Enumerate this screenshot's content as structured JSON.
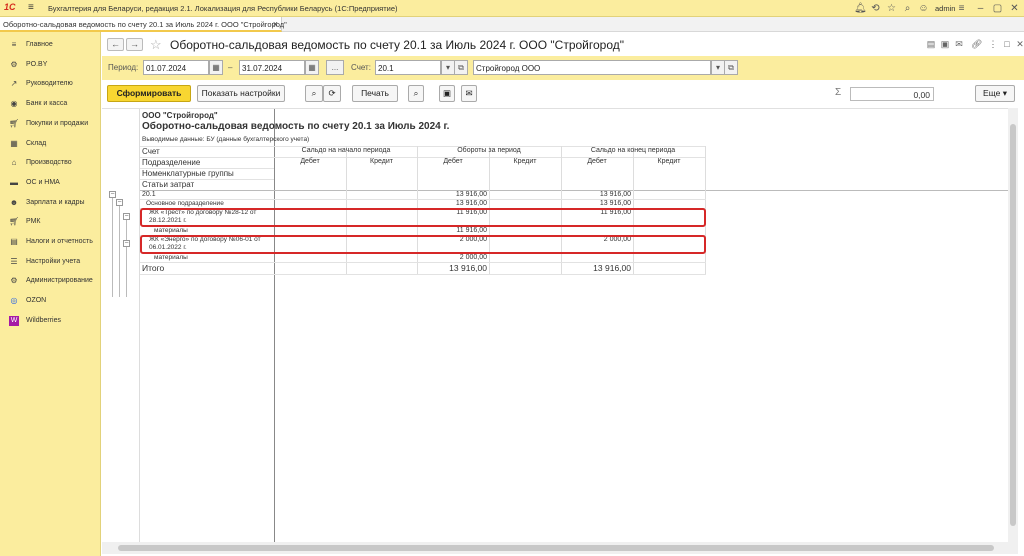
{
  "app": {
    "title": "Бухгалтерия для Беларуси, редакция 2.1. Локализация для Республики Беларусь   (1С:Предприятие)",
    "logo_text": "1С",
    "user": "admin"
  },
  "tab": {
    "label": "Оборотно-сальдовая ведомость по счету 20.1 за Июль 2024 г. ООО \"Стройгород\"",
    "close": "×"
  },
  "sidebar": {
    "items": [
      {
        "label": "Главное",
        "icon": "menu-icon"
      },
      {
        "label": "PO.BY",
        "icon": "settings-icon"
      },
      {
        "label": "Руководителю",
        "icon": "chart-icon"
      },
      {
        "label": "Банк и касса",
        "icon": "bank-icon"
      },
      {
        "label": "Покупки и продажи",
        "icon": "cart-icon"
      },
      {
        "label": "Склад",
        "icon": "warehouse-icon"
      },
      {
        "label": "Производство",
        "icon": "factory-icon"
      },
      {
        "label": "ОС и НМА",
        "icon": "car-icon"
      },
      {
        "label": "Зарплата и кадры",
        "icon": "people-icon"
      },
      {
        "label": "РМК",
        "icon": "cart-icon"
      },
      {
        "label": "Налоги и отчетность",
        "icon": "tax-icon"
      },
      {
        "label": "Настройки учета",
        "icon": "list-icon"
      },
      {
        "label": "Администрирование",
        "icon": "gear-icon"
      },
      {
        "label": "OZON",
        "icon": "ozon-icon"
      },
      {
        "label": "Wildberries",
        "icon": "wildberries-icon"
      }
    ]
  },
  "header": {
    "title": "Оборотно-сальдовая ведомость по счету 20.1 за Июль 2024 г. ООО \"Стройгород\""
  },
  "filters": {
    "period_label": "Период:",
    "date_from": "01.07.2024",
    "dash": "–",
    "date_to": "31.07.2024",
    "dots": "...",
    "account_label": "Счет:",
    "account": "20.1",
    "organization": "Стройгород ООО"
  },
  "toolbar": {
    "generate": "Сформировать",
    "settings": "Показать настройки",
    "print": "Печать",
    "sum_value": "0,00",
    "more": "Еще"
  },
  "report": {
    "org": "ООО \"Стройгород\"",
    "title": "Оборотно-сальдовая ведомость по счету 20.1 за Июль 2024 г.",
    "output_data": "Выводимые данные:  БУ (данные бухгалтерского учета)",
    "headers": {
      "account": "Счет",
      "division": "Подразделение",
      "nomenclature": "Номенклатурные группы",
      "cost_items": "Статьи затрат",
      "opening": "Сальдо на начало периода",
      "turnover": "Обороты за период",
      "closing": "Сальдо на конец периода",
      "debit": "Дебет",
      "credit": "Кредит"
    },
    "rows": [
      {
        "name": "20.1",
        "tdebit": "13 916,00",
        "cdebit": "13 916,00"
      },
      {
        "name": "Основное подразделение",
        "tdebit": "13 916,00",
        "cdebit": "13 916,00"
      },
      {
        "name": "ЖК «Трест» по договору №28-12 от",
        "name2": "28.12.2021 г.",
        "tdebit": "11 916,00",
        "cdebit": "11 916,00"
      },
      {
        "name": "материалы",
        "tdebit": "11 916,00",
        "cdebit": ""
      },
      {
        "name": "ЖК «Энерго» по договору №06-01 от",
        "name2": "06.01.2022 г.",
        "tdebit": "2 000,00",
        "cdebit": "2 000,00"
      },
      {
        "name": "материалы",
        "tdebit": "2 000,00",
        "cdebit": ""
      }
    ],
    "total": {
      "label": "Итого",
      "tdebit": "13 916,00",
      "cdebit": "13 916,00"
    }
  }
}
